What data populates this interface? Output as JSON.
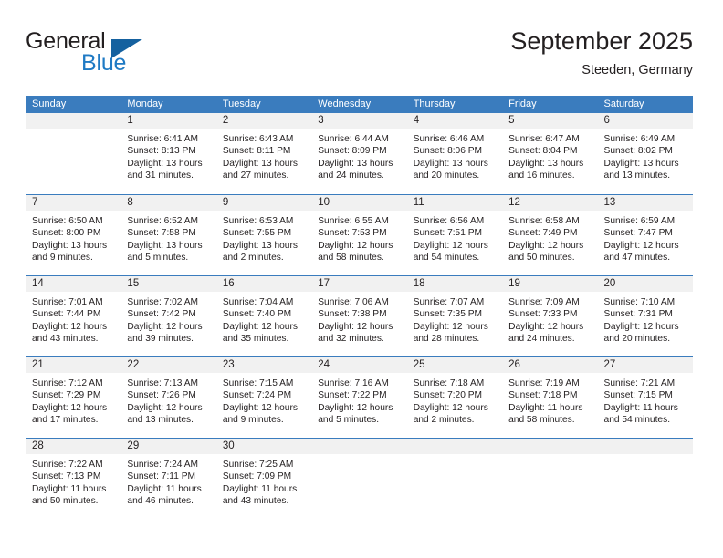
{
  "brand": {
    "name_part1": "General",
    "name_part2": "Blue",
    "accent_color": "#1f7ac4",
    "triangle_color": "#15619f"
  },
  "header": {
    "title": "September 2025",
    "subtitle": "Steeden, Germany"
  },
  "calendar": {
    "header_color": "#3a7cbe",
    "daynumber_band_color": "#f1f1f1",
    "weekdays": [
      "Sunday",
      "Monday",
      "Tuesday",
      "Wednesday",
      "Thursday",
      "Friday",
      "Saturday"
    ],
    "weeks": [
      [
        {
          "day": "",
          "lines": []
        },
        {
          "day": "1",
          "lines": [
            "Sunrise: 6:41 AM",
            "Sunset: 8:13 PM",
            "Daylight: 13 hours",
            "and 31 minutes."
          ]
        },
        {
          "day": "2",
          "lines": [
            "Sunrise: 6:43 AM",
            "Sunset: 8:11 PM",
            "Daylight: 13 hours",
            "and 27 minutes."
          ]
        },
        {
          "day": "3",
          "lines": [
            "Sunrise: 6:44 AM",
            "Sunset: 8:09 PM",
            "Daylight: 13 hours",
            "and 24 minutes."
          ]
        },
        {
          "day": "4",
          "lines": [
            "Sunrise: 6:46 AM",
            "Sunset: 8:06 PM",
            "Daylight: 13 hours",
            "and 20 minutes."
          ]
        },
        {
          "day": "5",
          "lines": [
            "Sunrise: 6:47 AM",
            "Sunset: 8:04 PM",
            "Daylight: 13 hours",
            "and 16 minutes."
          ]
        },
        {
          "day": "6",
          "lines": [
            "Sunrise: 6:49 AM",
            "Sunset: 8:02 PM",
            "Daylight: 13 hours",
            "and 13 minutes."
          ]
        }
      ],
      [
        {
          "day": "7",
          "lines": [
            "Sunrise: 6:50 AM",
            "Sunset: 8:00 PM",
            "Daylight: 13 hours",
            "and 9 minutes."
          ]
        },
        {
          "day": "8",
          "lines": [
            "Sunrise: 6:52 AM",
            "Sunset: 7:58 PM",
            "Daylight: 13 hours",
            "and 5 minutes."
          ]
        },
        {
          "day": "9",
          "lines": [
            "Sunrise: 6:53 AM",
            "Sunset: 7:55 PM",
            "Daylight: 13 hours",
            "and 2 minutes."
          ]
        },
        {
          "day": "10",
          "lines": [
            "Sunrise: 6:55 AM",
            "Sunset: 7:53 PM",
            "Daylight: 12 hours",
            "and 58 minutes."
          ]
        },
        {
          "day": "11",
          "lines": [
            "Sunrise: 6:56 AM",
            "Sunset: 7:51 PM",
            "Daylight: 12 hours",
            "and 54 minutes."
          ]
        },
        {
          "day": "12",
          "lines": [
            "Sunrise: 6:58 AM",
            "Sunset: 7:49 PM",
            "Daylight: 12 hours",
            "and 50 minutes."
          ]
        },
        {
          "day": "13",
          "lines": [
            "Sunrise: 6:59 AM",
            "Sunset: 7:47 PM",
            "Daylight: 12 hours",
            "and 47 minutes."
          ]
        }
      ],
      [
        {
          "day": "14",
          "lines": [
            "Sunrise: 7:01 AM",
            "Sunset: 7:44 PM",
            "Daylight: 12 hours",
            "and 43 minutes."
          ]
        },
        {
          "day": "15",
          "lines": [
            "Sunrise: 7:02 AM",
            "Sunset: 7:42 PM",
            "Daylight: 12 hours",
            "and 39 minutes."
          ]
        },
        {
          "day": "16",
          "lines": [
            "Sunrise: 7:04 AM",
            "Sunset: 7:40 PM",
            "Daylight: 12 hours",
            "and 35 minutes."
          ]
        },
        {
          "day": "17",
          "lines": [
            "Sunrise: 7:06 AM",
            "Sunset: 7:38 PM",
            "Daylight: 12 hours",
            "and 32 minutes."
          ]
        },
        {
          "day": "18",
          "lines": [
            "Sunrise: 7:07 AM",
            "Sunset: 7:35 PM",
            "Daylight: 12 hours",
            "and 28 minutes."
          ]
        },
        {
          "day": "19",
          "lines": [
            "Sunrise: 7:09 AM",
            "Sunset: 7:33 PM",
            "Daylight: 12 hours",
            "and 24 minutes."
          ]
        },
        {
          "day": "20",
          "lines": [
            "Sunrise: 7:10 AM",
            "Sunset: 7:31 PM",
            "Daylight: 12 hours",
            "and 20 minutes."
          ]
        }
      ],
      [
        {
          "day": "21",
          "lines": [
            "Sunrise: 7:12 AM",
            "Sunset: 7:29 PM",
            "Daylight: 12 hours",
            "and 17 minutes."
          ]
        },
        {
          "day": "22",
          "lines": [
            "Sunrise: 7:13 AM",
            "Sunset: 7:26 PM",
            "Daylight: 12 hours",
            "and 13 minutes."
          ]
        },
        {
          "day": "23",
          "lines": [
            "Sunrise: 7:15 AM",
            "Sunset: 7:24 PM",
            "Daylight: 12 hours",
            "and 9 minutes."
          ]
        },
        {
          "day": "24",
          "lines": [
            "Sunrise: 7:16 AM",
            "Sunset: 7:22 PM",
            "Daylight: 12 hours",
            "and 5 minutes."
          ]
        },
        {
          "day": "25",
          "lines": [
            "Sunrise: 7:18 AM",
            "Sunset: 7:20 PM",
            "Daylight: 12 hours",
            "and 2 minutes."
          ]
        },
        {
          "day": "26",
          "lines": [
            "Sunrise: 7:19 AM",
            "Sunset: 7:18 PM",
            "Daylight: 11 hours",
            "and 58 minutes."
          ]
        },
        {
          "day": "27",
          "lines": [
            "Sunrise: 7:21 AM",
            "Sunset: 7:15 PM",
            "Daylight: 11 hours",
            "and 54 minutes."
          ]
        }
      ],
      [
        {
          "day": "28",
          "lines": [
            "Sunrise: 7:22 AM",
            "Sunset: 7:13 PM",
            "Daylight: 11 hours",
            "and 50 minutes."
          ]
        },
        {
          "day": "29",
          "lines": [
            "Sunrise: 7:24 AM",
            "Sunset: 7:11 PM",
            "Daylight: 11 hours",
            "and 46 minutes."
          ]
        },
        {
          "day": "30",
          "lines": [
            "Sunrise: 7:25 AM",
            "Sunset: 7:09 PM",
            "Daylight: 11 hours",
            "and 43 minutes."
          ]
        },
        {
          "day": "",
          "lines": []
        },
        {
          "day": "",
          "lines": []
        },
        {
          "day": "",
          "lines": []
        },
        {
          "day": "",
          "lines": []
        }
      ]
    ]
  }
}
